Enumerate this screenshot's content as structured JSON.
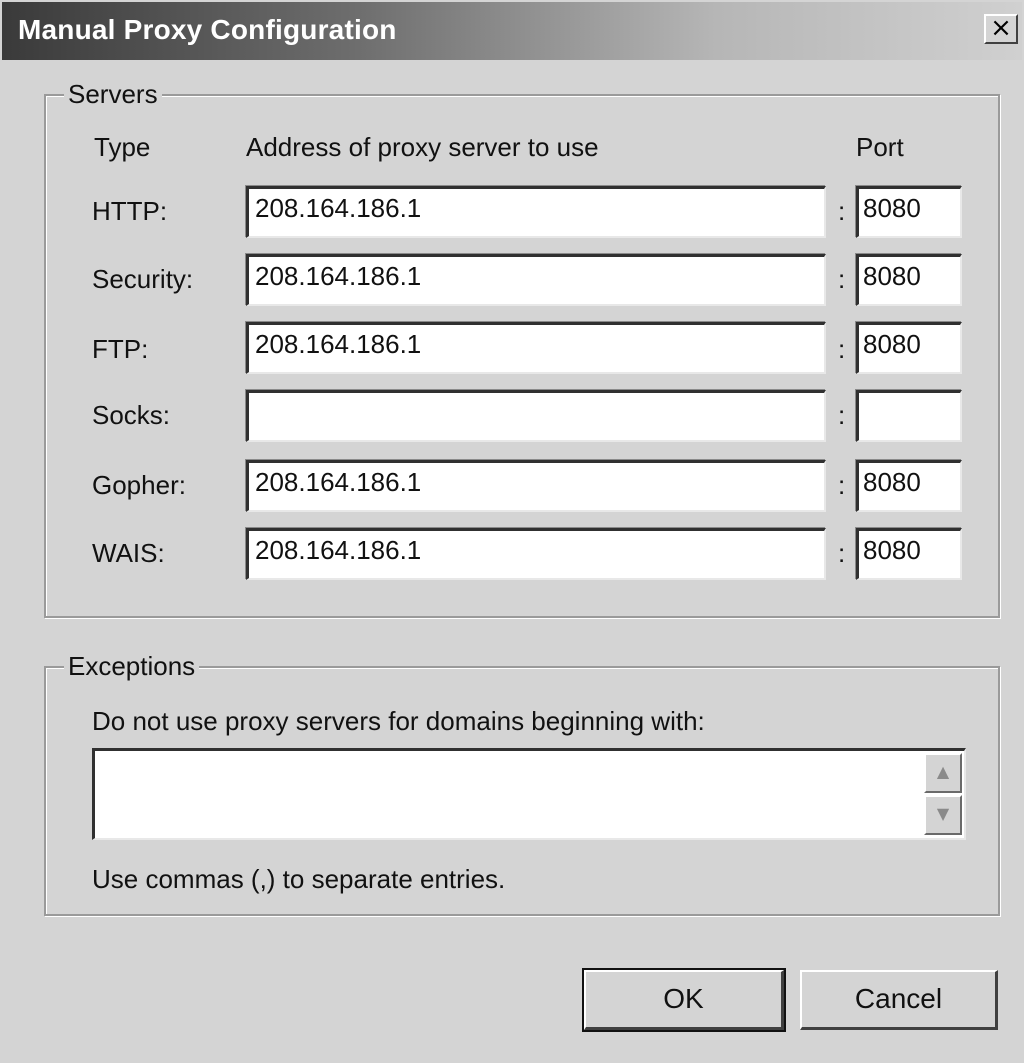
{
  "window": {
    "title": "Manual Proxy Configuration",
    "close_glyph": "×"
  },
  "servers": {
    "legend": "Servers",
    "headers": {
      "type": "Type",
      "address": "Address of proxy server to use",
      "port": "Port"
    },
    "separator": ":",
    "rows": [
      {
        "type": "HTTP:",
        "address": "208.164.186.1",
        "port": "8080"
      },
      {
        "type": "Security:",
        "address": "208.164.186.1",
        "port": "8080"
      },
      {
        "type": "FTP:",
        "address": "208.164.186.1",
        "port": "8080"
      },
      {
        "type": "Socks:",
        "address": "",
        "port": ""
      },
      {
        "type": "Gopher:",
        "address": "208.164.186.1",
        "port": "8080"
      },
      {
        "type": "WAIS:",
        "address": "208.164.186.1",
        "port": "8080"
      }
    ]
  },
  "exceptions": {
    "legend": "Exceptions",
    "instruction": "Do not use proxy servers for domains beginning with:",
    "value": "",
    "hint": "Use commas (,) to separate entries.",
    "scroll_up_icon": "scroll-up-arrow",
    "scroll_down_icon": "scroll-down-arrow"
  },
  "buttons": {
    "ok": "OK",
    "cancel": "Cancel"
  }
}
